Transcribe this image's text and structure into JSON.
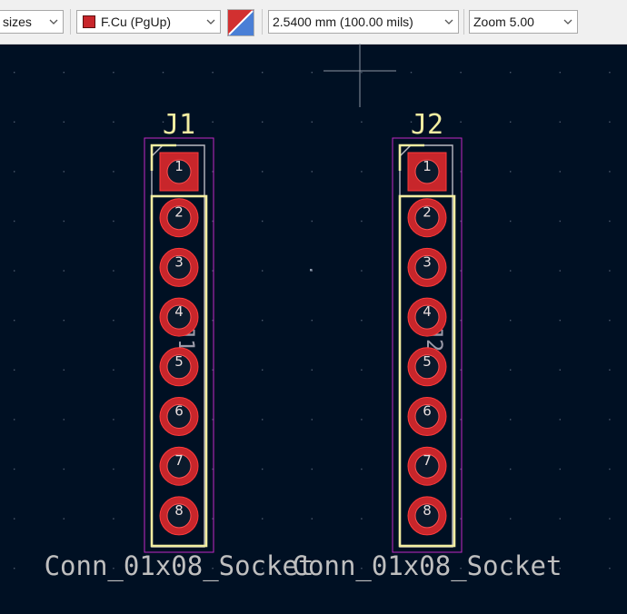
{
  "toolbar": {
    "sizes_label": "sizes",
    "layer_label": "F.Cu (PgUp)",
    "layer_color": "#c8262b",
    "grid_label": "2.5400 mm (100.00 mils)",
    "zoom_label": "Zoom 5.00"
  },
  "colors": {
    "background": "#001023",
    "pad_copper": "#c8262b",
    "silkscreen": "#f2eda1",
    "courtyard": "#c227c6",
    "fab_text": "#9a9aa8"
  },
  "footprints": [
    {
      "reference": "J1",
      "value": "Conn_01x08_Socket",
      "fab_ref": "J1",
      "pins": [
        "1",
        "2",
        "3",
        "4",
        "5",
        "6",
        "7",
        "8"
      ]
    },
    {
      "reference": "J2",
      "value": "Conn_01x08_Socket",
      "fab_ref": "J2",
      "pins": [
        "1",
        "2",
        "3",
        "4",
        "5",
        "6",
        "7",
        "8"
      ]
    }
  ]
}
